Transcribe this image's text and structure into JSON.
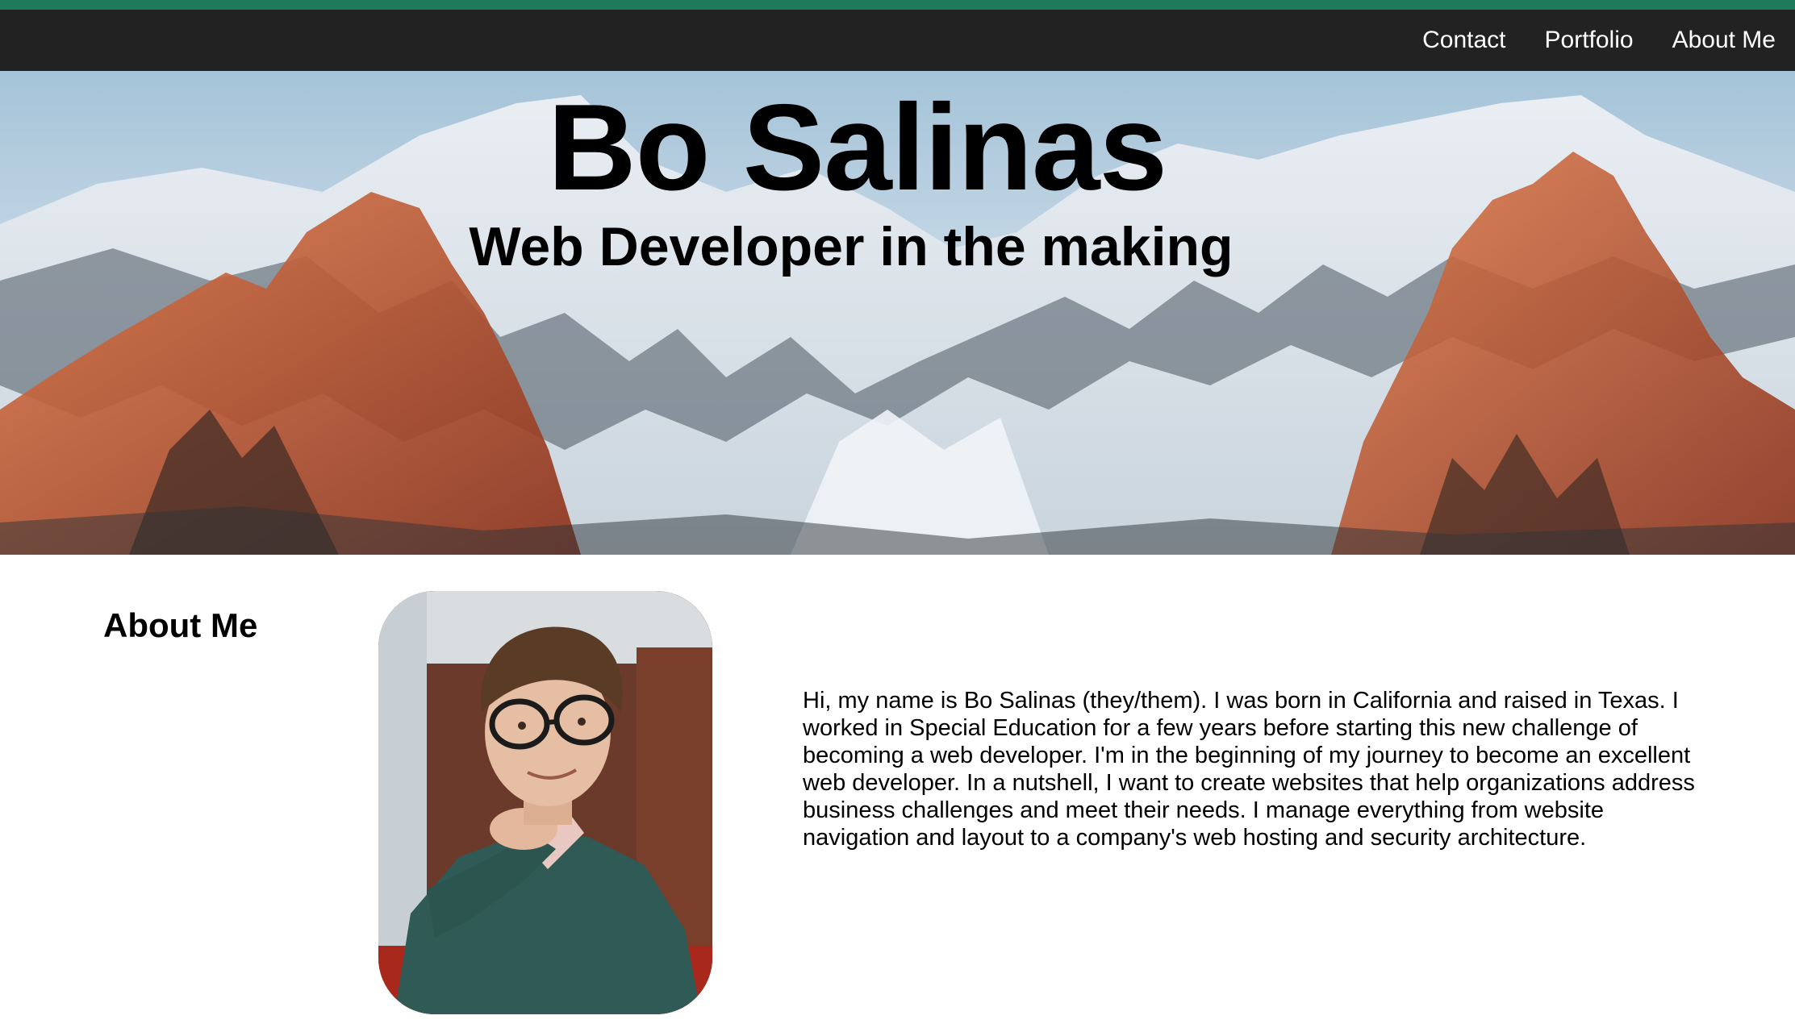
{
  "colors": {
    "accent": "#1f7a5c",
    "navbar_bg": "#222222",
    "nav_text": "#ffffff"
  },
  "nav": {
    "items": [
      {
        "label": "Contact"
      },
      {
        "label": "Portfolio"
      },
      {
        "label": "About Me"
      }
    ]
  },
  "hero": {
    "title": "Bo Salinas",
    "subtitle": "Web Developer in the making"
  },
  "about": {
    "heading": "About Me",
    "text": "Hi, my name is Bo Salinas (they/them). I was born in California and raised in Texas. I worked in Special Education for a few years before starting this new challenge of becoming a web developer. I'm in the beginning of my journey to become an excellent web developer. In a nutshell, I want to create websites that help organizations address business challenges and meet their needs. I manage everything from website navigation and layout to a company's web hosting and security architecture."
  }
}
